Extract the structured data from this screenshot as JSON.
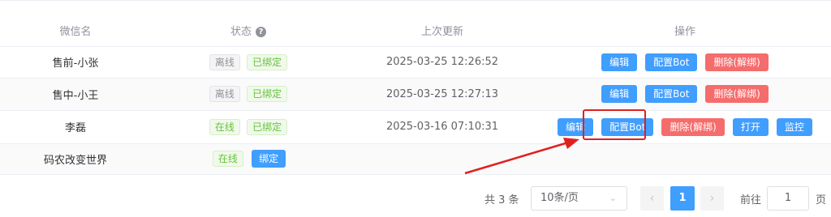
{
  "table": {
    "headers": {
      "name": "微信名",
      "status": "状态",
      "updated": "上次更新",
      "actions": "操作"
    },
    "rows": [
      {
        "name": "售前-小张",
        "online": "离线",
        "bound": "已绑定",
        "updated": "2025-03-25 12:26:52",
        "actions": [
          "编辑",
          "配置Bot",
          "删除(解绑)"
        ]
      },
      {
        "name": "售中-小王",
        "online": "离线",
        "bound": "已绑定",
        "updated": "2025-03-25 12:27:13",
        "actions": [
          "编辑",
          "配置Bot",
          "删除(解绑)"
        ]
      },
      {
        "name": "李磊",
        "online": "在线",
        "bound": "已绑定",
        "updated": "2025-03-16 07:10:31",
        "actions": [
          "编辑",
          "配置Bot",
          "删除(解绑)",
          "打开",
          "监控"
        ]
      },
      {
        "name": "码农改变世界",
        "online": "在线",
        "bind_button": "绑定",
        "updated": ""
      }
    ]
  },
  "pagination": {
    "total": "共 3 条",
    "page_size": "10条/页",
    "current_page": "1",
    "goto_label": "前往",
    "goto_value": "1",
    "page_suffix": "页"
  },
  "icons": {
    "help": "question-circle-icon",
    "select": "chevron-down-icon",
    "prev": "chevron-left-icon",
    "next": "chevron-right-icon"
  },
  "colors": {
    "primary": "#409eff",
    "danger": "#f56c6c",
    "success": "#67c23a",
    "annotation": "#e02020"
  }
}
